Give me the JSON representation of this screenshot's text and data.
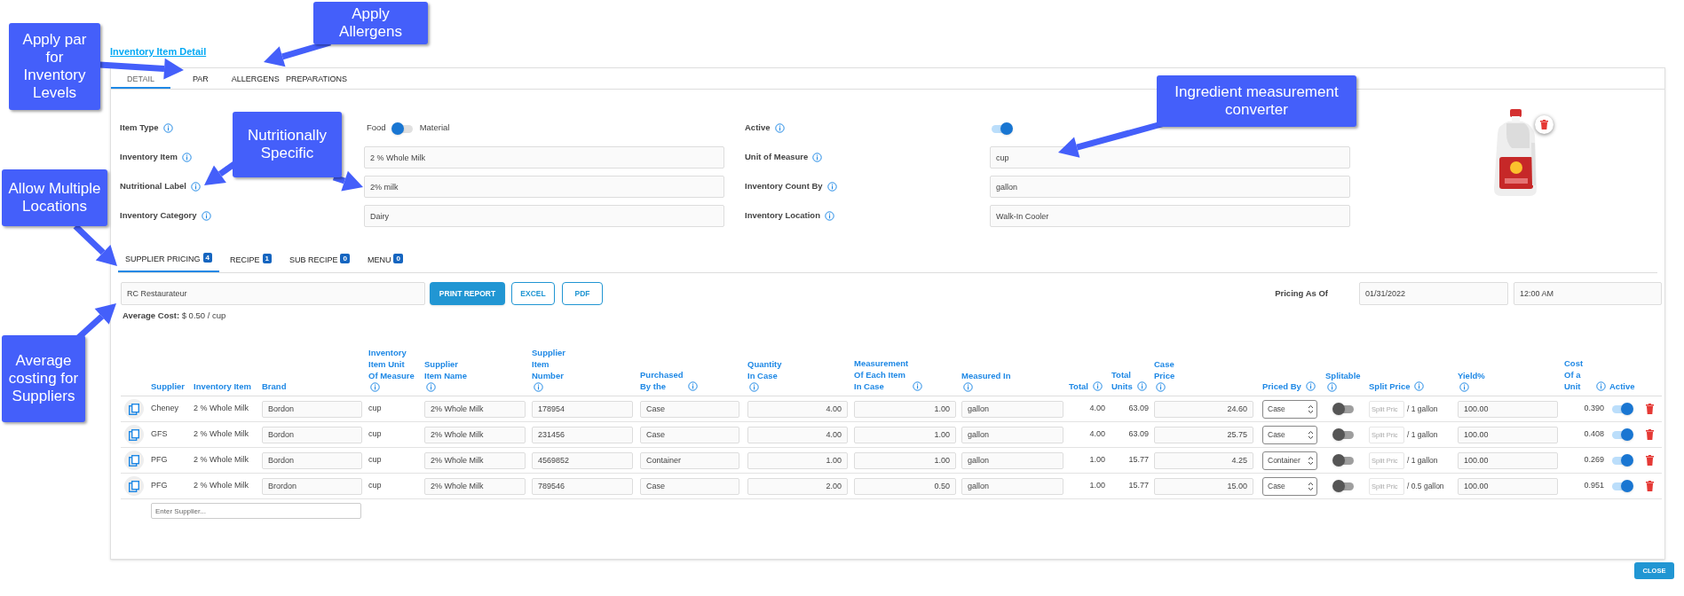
{
  "title": "Inventory Item Detail",
  "tabs": [
    {
      "label": "DETAIL",
      "selected": true
    },
    {
      "label": "PAR",
      "selected": false
    },
    {
      "label": "ALLERGENS",
      "selected": false
    },
    {
      "label": "PREPARATIONS",
      "selected": false
    }
  ],
  "form": {
    "left": [
      {
        "kind": "switch",
        "label": "Item Type",
        "off_label": "Food",
        "on_label": "Material",
        "on": false
      },
      {
        "kind": "field",
        "label": "Inventory Item",
        "value": "2 % Whole Milk"
      },
      {
        "kind": "field",
        "label": "Nutritional Label",
        "value": "2% milk"
      },
      {
        "kind": "field",
        "label": "Inventory Category",
        "value": "Dairy"
      }
    ],
    "right": [
      {
        "kind": "toggle",
        "label": "Active",
        "on": true
      },
      {
        "kind": "field",
        "label": "Unit of Measure",
        "value": "cup"
      },
      {
        "kind": "field",
        "label": "Inventory Count By",
        "value": "gallon"
      },
      {
        "kind": "field",
        "label": "Inventory Location",
        "value": "Walk-In Cooler"
      }
    ]
  },
  "sub_tabs": [
    {
      "label": "SUPPLIER PRICING",
      "count": "4",
      "selected": true
    },
    {
      "label": "RECIPE",
      "count": "1",
      "selected": false
    },
    {
      "label": "SUB RECIPE",
      "count": "0",
      "selected": false
    },
    {
      "label": "MENU",
      "count": "0",
      "selected": false
    }
  ],
  "toolbar": {
    "supplier_filter": "RC Restaurateur",
    "buttons": [
      {
        "label": "PRINT REPORT",
        "kind": "primary"
      },
      {
        "label": "EXCEL",
        "kind": "outline"
      },
      {
        "label": "PDF",
        "kind": "outline"
      }
    ],
    "pricing_as_of_label": "Pricing As Of",
    "date": "01/31/2022",
    "time": "12:00 AM"
  },
  "average_cost": "**Average Cost:** $ 0.50 / cup",
  "table": {
    "columns": [
      {
        "label": "Supplier",
        "info": false
      },
      {
        "label": "Inventory Item",
        "info": false
      },
      {
        "label": "Brand",
        "info": false
      },
      {
        "label": "Inventory\nItem Unit\nOf Measure",
        "info": true,
        "info_below": true
      },
      {
        "label": "Supplier\nItem Name",
        "info": true,
        "info_below": true
      },
      {
        "label": "Supplier\nItem\nNumber",
        "info": true,
        "info_below": true
      },
      {
        "label": "Purchased\nBy the",
        "info": true,
        "info_below": false
      },
      {
        "label": "Quantity\nIn Case",
        "info": true,
        "info_below": true
      },
      {
        "label": "Measurement\nOf Each Item\nIn Case",
        "info": true,
        "info_below": false
      },
      {
        "label": "Measured In",
        "info": true,
        "info_below": true
      },
      {
        "label": "Total",
        "info": true,
        "info_below": false
      },
      {
        "label": "Total\nUnits",
        "info": true,
        "info_below": false
      },
      {
        "label": "Case\nPrice",
        "info": true,
        "info_below": true
      },
      {
        "label": "Priced By",
        "info": true,
        "info_below": false
      },
      {
        "label": "Splitable",
        "info": true,
        "info_below": true
      },
      {
        "label": "Split Price",
        "info": true,
        "info_below": false
      },
      {
        "label": "Yield%",
        "info": true,
        "info_below": true
      },
      {
        "label": "Cost Of a\nUnit",
        "info": true,
        "info_below": false
      },
      {
        "label": "Active",
        "info": false
      }
    ],
    "rows": [
      {
        "supplier": "Cheney",
        "inventory_item": "2 % Whole Milk",
        "brand": "Bordon",
        "unit": "cup",
        "supplier_item_name": "2% Whole Milk",
        "item_number": "178954",
        "purchased_by": "Case",
        "quantity": "4.00",
        "measurement": "1.00",
        "measured_in": "gallon",
        "total": "4.00",
        "total_units": "63.09",
        "case_price": "24.60",
        "priced_by": "Case",
        "splitable": false,
        "split_price": "Split Pric",
        "split_unit": "/ 1 gallon",
        "yield": "100.00",
        "cost": "0.390",
        "active": true
      },
      {
        "supplier": "GFS",
        "inventory_item": "2 % Whole Milk",
        "brand": "Bordon",
        "unit": "cup",
        "supplier_item_name": "2% Whole Milk",
        "item_number": "231456",
        "purchased_by": "Case",
        "quantity": "4.00",
        "measurement": "1.00",
        "measured_in": "gallon",
        "total": "4.00",
        "total_units": "63.09",
        "case_price": "25.75",
        "priced_by": "Case",
        "splitable": false,
        "split_price": "Split Pric",
        "split_unit": "/ 1 gallon",
        "yield": "100.00",
        "cost": "0.408",
        "active": true
      },
      {
        "supplier": "PFG",
        "inventory_item": "2 % Whole Milk",
        "brand": "Bordon",
        "unit": "cup",
        "supplier_item_name": "2% Whole Milk",
        "item_number": "4569852",
        "purchased_by": "Container",
        "quantity": "1.00",
        "measurement": "1.00",
        "measured_in": "gallon",
        "total": "1.00",
        "total_units": "15.77",
        "case_price": "4.25",
        "priced_by": "Container",
        "splitable": false,
        "split_price": "Split Pric",
        "split_unit": "/ 1 gallon",
        "yield": "100.00",
        "cost": "0.269",
        "active": true
      },
      {
        "supplier": "PFG",
        "inventory_item": "2 % Whole Milk",
        "brand": "Brordon",
        "unit": "cup",
        "supplier_item_name": "2% Whole Milk",
        "item_number": "789546",
        "purchased_by": "Case",
        "quantity": "2.00",
        "measurement": "0.50",
        "measured_in": "gallon",
        "total": "1.00",
        "total_units": "15.77",
        "case_price": "15.00",
        "priced_by": "Case",
        "splitable": false,
        "split_price": "Split Pric",
        "split_unit": "/ 0.5 gallon",
        "yield": "100.00",
        "cost": "0.951",
        "active": true
      }
    ],
    "new_supplier_placeholder": "Enter Supplier..."
  },
  "close_button": "CLOSE",
  "callouts": [
    {
      "text": "Apply\nAllergens"
    },
    {
      "text": "Apply par\nfor\nInventory\nLevels"
    },
    {
      "text": "Ingredient measurement\nconverter"
    },
    {
      "text": "Nutritionally\nSpecific"
    },
    {
      "text": "Allow Multiple\nLocations"
    },
    {
      "text": "Average\ncosting for\nSuppliers"
    }
  ]
}
